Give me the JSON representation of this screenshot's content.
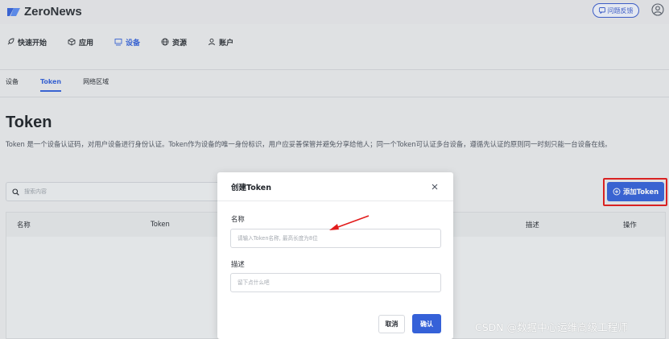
{
  "app": {
    "name": "ZeroNews",
    "feedback_label": "问题反馈"
  },
  "mainnav": {
    "items": [
      {
        "label": "快速开始",
        "icon": "rocket-icon"
      },
      {
        "label": "应用",
        "icon": "cube-icon"
      },
      {
        "label": "设备",
        "icon": "monitor-icon",
        "active": true
      },
      {
        "label": "资源",
        "icon": "globe-icon"
      },
      {
        "label": "账户",
        "icon": "user-icon"
      }
    ]
  },
  "subtabs": {
    "items": [
      {
        "label": "设备"
      },
      {
        "label": "Token",
        "active": true
      },
      {
        "label": "网络区域"
      }
    ]
  },
  "page": {
    "title": "Token",
    "description": "Token 是一个设备认证码，对用户设备进行身份认证。Token作为设备的唯一身份标识，用户应妥善保管并避免分享给他人；同一个Token可认证多台设备，遵循先认证的原则同一时刻只能一台设备在线。"
  },
  "search": {
    "placeholder": "搜索内容"
  },
  "add_button": {
    "label": "添加Token",
    "icon": "plus-circle-icon"
  },
  "table": {
    "columns": [
      "名称",
      "Token",
      "描述",
      "操作"
    ]
  },
  "modal": {
    "title": "创建Token",
    "name_label": "名称",
    "name_placeholder": "请输入Token名称, 最高长度为8位",
    "desc_label": "描述",
    "desc_placeholder": "留下点什么吧",
    "cancel_label": "取消",
    "confirm_label": "确认"
  },
  "watermark": "CSDN @数据中心运维高级工程师",
  "colors": {
    "accent": "#3561d8",
    "highlight": "#e21b1b"
  }
}
